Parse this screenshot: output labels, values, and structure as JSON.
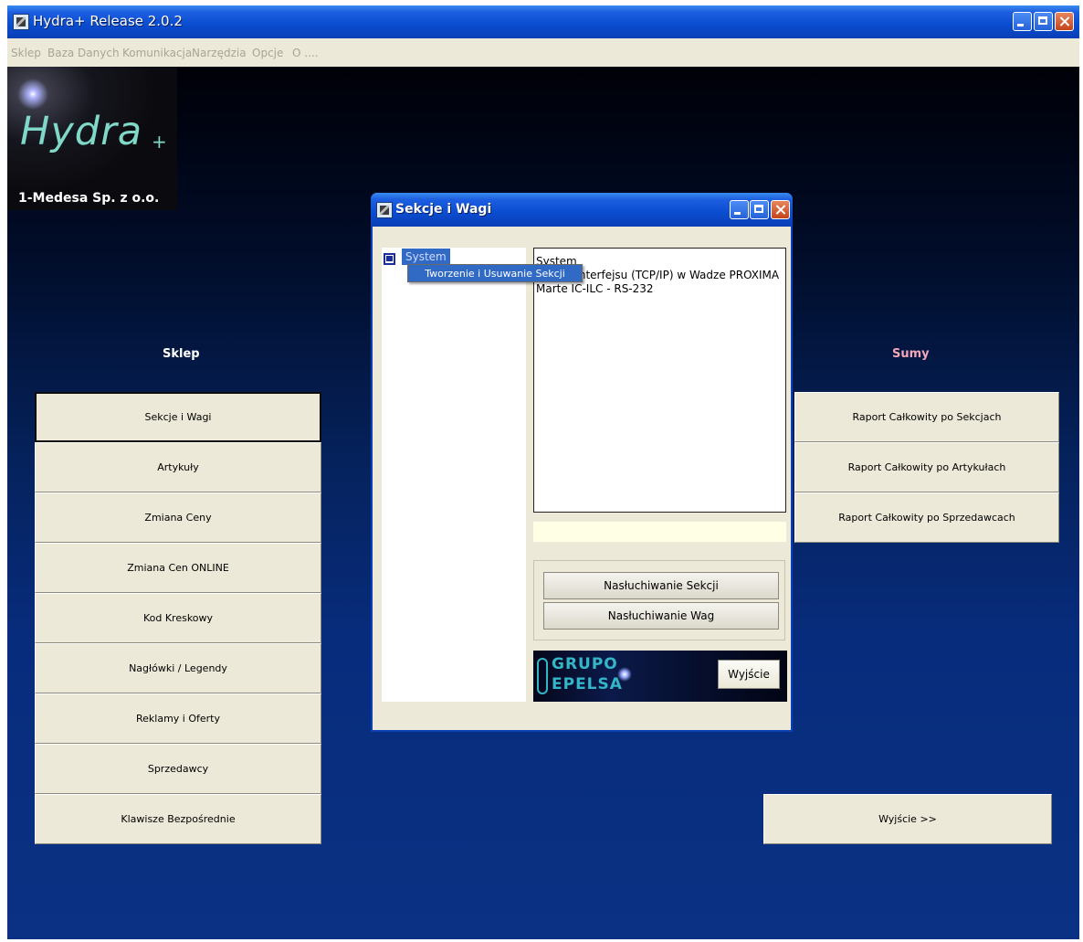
{
  "window": {
    "title": "Hydra+ Release 2.0.2"
  },
  "menu": [
    "Sklep",
    "Baza Danych",
    "Komunikacja",
    "Narzędzia",
    "Opcje",
    "O ...."
  ],
  "logo": {
    "name": "Hydra",
    "plus": "+",
    "company": "1-Medesa Sp. z o.o."
  },
  "sklep": {
    "title": "Sklep",
    "buttons": [
      "Sekcje i Wagi",
      "Artykuły",
      "Zmiana Ceny",
      "Zmiana Cen ONLINE",
      "Kod Kreskowy",
      "Nagłówki / Legendy",
      "Reklamy i Oferty",
      "Sprzedawcy",
      "Klawisze Bezpośrednie"
    ]
  },
  "sumy": {
    "title": "Sumy",
    "buttons": [
      "Raport Całkowity po Sekcjach",
      "Raport Całkowity po Artykułach",
      "Raport Całkowity po Sprzedawcach"
    ],
    "exit": "Wyjście >>"
  },
  "dialog": {
    "title": "Sekcje i Wagi",
    "tree_node": "System",
    "context_menu": "Tworzenie i Usuwanie Sekcji",
    "info_lines": [
      "System",
      "Użycie Interfejsu (TCP/IP) w Wadze PROXIMA",
      "Marte IC-ILC - RS-232"
    ],
    "btn_listen_sections": "Nasłuchiwanie Sekcji",
    "btn_listen_scales": "Nasłuchiwanie Wag",
    "logo_line1": "GRUPO",
    "logo_line2": "EPELSA",
    "exit": "Wyjście"
  },
  "colors": {
    "titlebar": "#0a4ccf",
    "background": "#082c7c",
    "button_face": "#ece9d8",
    "sumy_title": "#f2a8b8",
    "selection": "#316ac5"
  }
}
